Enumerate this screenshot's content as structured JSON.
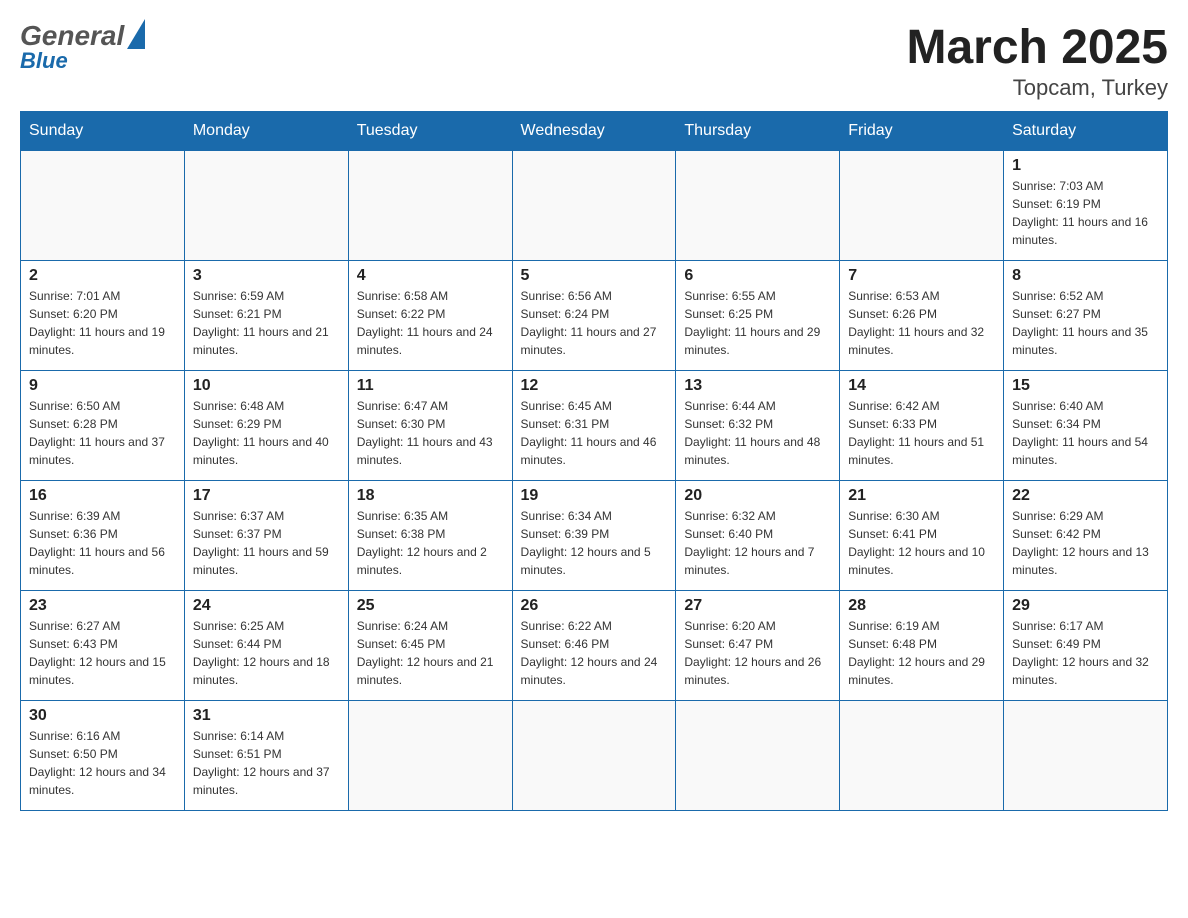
{
  "header": {
    "logo_general": "General",
    "logo_blue": "Blue",
    "month_year": "March 2025",
    "location": "Topcam, Turkey"
  },
  "days_of_week": [
    "Sunday",
    "Monday",
    "Tuesday",
    "Wednesday",
    "Thursday",
    "Friday",
    "Saturday"
  ],
  "weeks": [
    [
      {
        "day": "",
        "sunrise": "",
        "sunset": "",
        "daylight": ""
      },
      {
        "day": "",
        "sunrise": "",
        "sunset": "",
        "daylight": ""
      },
      {
        "day": "",
        "sunrise": "",
        "sunset": "",
        "daylight": ""
      },
      {
        "day": "",
        "sunrise": "",
        "sunset": "",
        "daylight": ""
      },
      {
        "day": "",
        "sunrise": "",
        "sunset": "",
        "daylight": ""
      },
      {
        "day": "",
        "sunrise": "",
        "sunset": "",
        "daylight": ""
      },
      {
        "day": "1",
        "sunrise": "Sunrise: 7:03 AM",
        "sunset": "Sunset: 6:19 PM",
        "daylight": "Daylight: 11 hours and 16 minutes."
      }
    ],
    [
      {
        "day": "2",
        "sunrise": "Sunrise: 7:01 AM",
        "sunset": "Sunset: 6:20 PM",
        "daylight": "Daylight: 11 hours and 19 minutes."
      },
      {
        "day": "3",
        "sunrise": "Sunrise: 6:59 AM",
        "sunset": "Sunset: 6:21 PM",
        "daylight": "Daylight: 11 hours and 21 minutes."
      },
      {
        "day": "4",
        "sunrise": "Sunrise: 6:58 AM",
        "sunset": "Sunset: 6:22 PM",
        "daylight": "Daylight: 11 hours and 24 minutes."
      },
      {
        "day": "5",
        "sunrise": "Sunrise: 6:56 AM",
        "sunset": "Sunset: 6:24 PM",
        "daylight": "Daylight: 11 hours and 27 minutes."
      },
      {
        "day": "6",
        "sunrise": "Sunrise: 6:55 AM",
        "sunset": "Sunset: 6:25 PM",
        "daylight": "Daylight: 11 hours and 29 minutes."
      },
      {
        "day": "7",
        "sunrise": "Sunrise: 6:53 AM",
        "sunset": "Sunset: 6:26 PM",
        "daylight": "Daylight: 11 hours and 32 minutes."
      },
      {
        "day": "8",
        "sunrise": "Sunrise: 6:52 AM",
        "sunset": "Sunset: 6:27 PM",
        "daylight": "Daylight: 11 hours and 35 minutes."
      }
    ],
    [
      {
        "day": "9",
        "sunrise": "Sunrise: 6:50 AM",
        "sunset": "Sunset: 6:28 PM",
        "daylight": "Daylight: 11 hours and 37 minutes."
      },
      {
        "day": "10",
        "sunrise": "Sunrise: 6:48 AM",
        "sunset": "Sunset: 6:29 PM",
        "daylight": "Daylight: 11 hours and 40 minutes."
      },
      {
        "day": "11",
        "sunrise": "Sunrise: 6:47 AM",
        "sunset": "Sunset: 6:30 PM",
        "daylight": "Daylight: 11 hours and 43 minutes."
      },
      {
        "day": "12",
        "sunrise": "Sunrise: 6:45 AM",
        "sunset": "Sunset: 6:31 PM",
        "daylight": "Daylight: 11 hours and 46 minutes."
      },
      {
        "day": "13",
        "sunrise": "Sunrise: 6:44 AM",
        "sunset": "Sunset: 6:32 PM",
        "daylight": "Daylight: 11 hours and 48 minutes."
      },
      {
        "day": "14",
        "sunrise": "Sunrise: 6:42 AM",
        "sunset": "Sunset: 6:33 PM",
        "daylight": "Daylight: 11 hours and 51 minutes."
      },
      {
        "day": "15",
        "sunrise": "Sunrise: 6:40 AM",
        "sunset": "Sunset: 6:34 PM",
        "daylight": "Daylight: 11 hours and 54 minutes."
      }
    ],
    [
      {
        "day": "16",
        "sunrise": "Sunrise: 6:39 AM",
        "sunset": "Sunset: 6:36 PM",
        "daylight": "Daylight: 11 hours and 56 minutes."
      },
      {
        "day": "17",
        "sunrise": "Sunrise: 6:37 AM",
        "sunset": "Sunset: 6:37 PM",
        "daylight": "Daylight: 11 hours and 59 minutes."
      },
      {
        "day": "18",
        "sunrise": "Sunrise: 6:35 AM",
        "sunset": "Sunset: 6:38 PM",
        "daylight": "Daylight: 12 hours and 2 minutes."
      },
      {
        "day": "19",
        "sunrise": "Sunrise: 6:34 AM",
        "sunset": "Sunset: 6:39 PM",
        "daylight": "Daylight: 12 hours and 5 minutes."
      },
      {
        "day": "20",
        "sunrise": "Sunrise: 6:32 AM",
        "sunset": "Sunset: 6:40 PM",
        "daylight": "Daylight: 12 hours and 7 minutes."
      },
      {
        "day": "21",
        "sunrise": "Sunrise: 6:30 AM",
        "sunset": "Sunset: 6:41 PM",
        "daylight": "Daylight: 12 hours and 10 minutes."
      },
      {
        "day": "22",
        "sunrise": "Sunrise: 6:29 AM",
        "sunset": "Sunset: 6:42 PM",
        "daylight": "Daylight: 12 hours and 13 minutes."
      }
    ],
    [
      {
        "day": "23",
        "sunrise": "Sunrise: 6:27 AM",
        "sunset": "Sunset: 6:43 PM",
        "daylight": "Daylight: 12 hours and 15 minutes."
      },
      {
        "day": "24",
        "sunrise": "Sunrise: 6:25 AM",
        "sunset": "Sunset: 6:44 PM",
        "daylight": "Daylight: 12 hours and 18 minutes."
      },
      {
        "day": "25",
        "sunrise": "Sunrise: 6:24 AM",
        "sunset": "Sunset: 6:45 PM",
        "daylight": "Daylight: 12 hours and 21 minutes."
      },
      {
        "day": "26",
        "sunrise": "Sunrise: 6:22 AM",
        "sunset": "Sunset: 6:46 PM",
        "daylight": "Daylight: 12 hours and 24 minutes."
      },
      {
        "day": "27",
        "sunrise": "Sunrise: 6:20 AM",
        "sunset": "Sunset: 6:47 PM",
        "daylight": "Daylight: 12 hours and 26 minutes."
      },
      {
        "day": "28",
        "sunrise": "Sunrise: 6:19 AM",
        "sunset": "Sunset: 6:48 PM",
        "daylight": "Daylight: 12 hours and 29 minutes."
      },
      {
        "day": "29",
        "sunrise": "Sunrise: 6:17 AM",
        "sunset": "Sunset: 6:49 PM",
        "daylight": "Daylight: 12 hours and 32 minutes."
      }
    ],
    [
      {
        "day": "30",
        "sunrise": "Sunrise: 6:16 AM",
        "sunset": "Sunset: 6:50 PM",
        "daylight": "Daylight: 12 hours and 34 minutes."
      },
      {
        "day": "31",
        "sunrise": "Sunrise: 6:14 AM",
        "sunset": "Sunset: 6:51 PM",
        "daylight": "Daylight: 12 hours and 37 minutes."
      },
      {
        "day": "",
        "sunrise": "",
        "sunset": "",
        "daylight": ""
      },
      {
        "day": "",
        "sunrise": "",
        "sunset": "",
        "daylight": ""
      },
      {
        "day": "",
        "sunrise": "",
        "sunset": "",
        "daylight": ""
      },
      {
        "day": "",
        "sunrise": "",
        "sunset": "",
        "daylight": ""
      },
      {
        "day": "",
        "sunrise": "",
        "sunset": "",
        "daylight": ""
      }
    ]
  ]
}
